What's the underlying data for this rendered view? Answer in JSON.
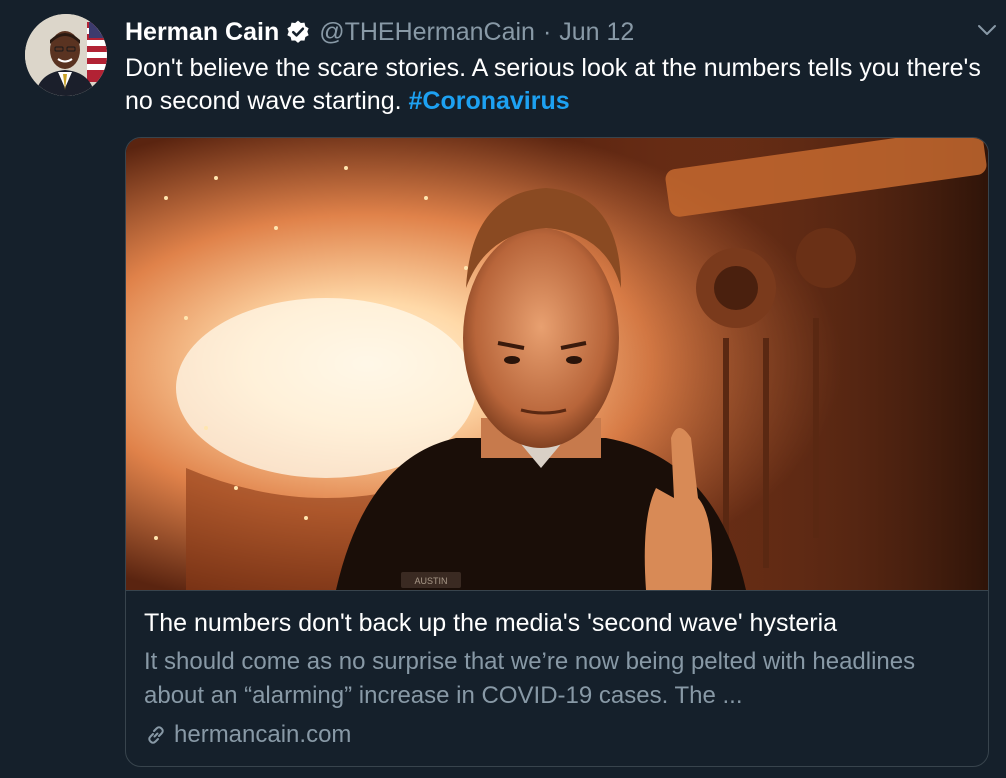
{
  "tweet": {
    "author_name": "Herman Cain",
    "handle": "@THEHermanCain",
    "separator": "·",
    "date": "Jun 12",
    "text_main": "Don't believe the scare stories. A serious look at the numbers tells you there's no second wave starting. ",
    "hashtag": "#Coronavirus"
  },
  "card": {
    "title": "The numbers don't back up the media's 'second wave' hysteria",
    "description": "It should come as no surprise that we’re now being pelted with headlines about an “alarming” increase in COVID-19 cases. The ...",
    "domain": "hermancain.com",
    "image_badge_text": "AUSTIN"
  },
  "colors": {
    "background": "#15202b",
    "text_primary": "#ffffff",
    "text_secondary": "#8899a6",
    "accent": "#1da1f2",
    "border": "#38444d"
  },
  "icons": {
    "verified": "verified-badge-icon",
    "more": "chevron-down-icon",
    "link": "link-icon"
  }
}
